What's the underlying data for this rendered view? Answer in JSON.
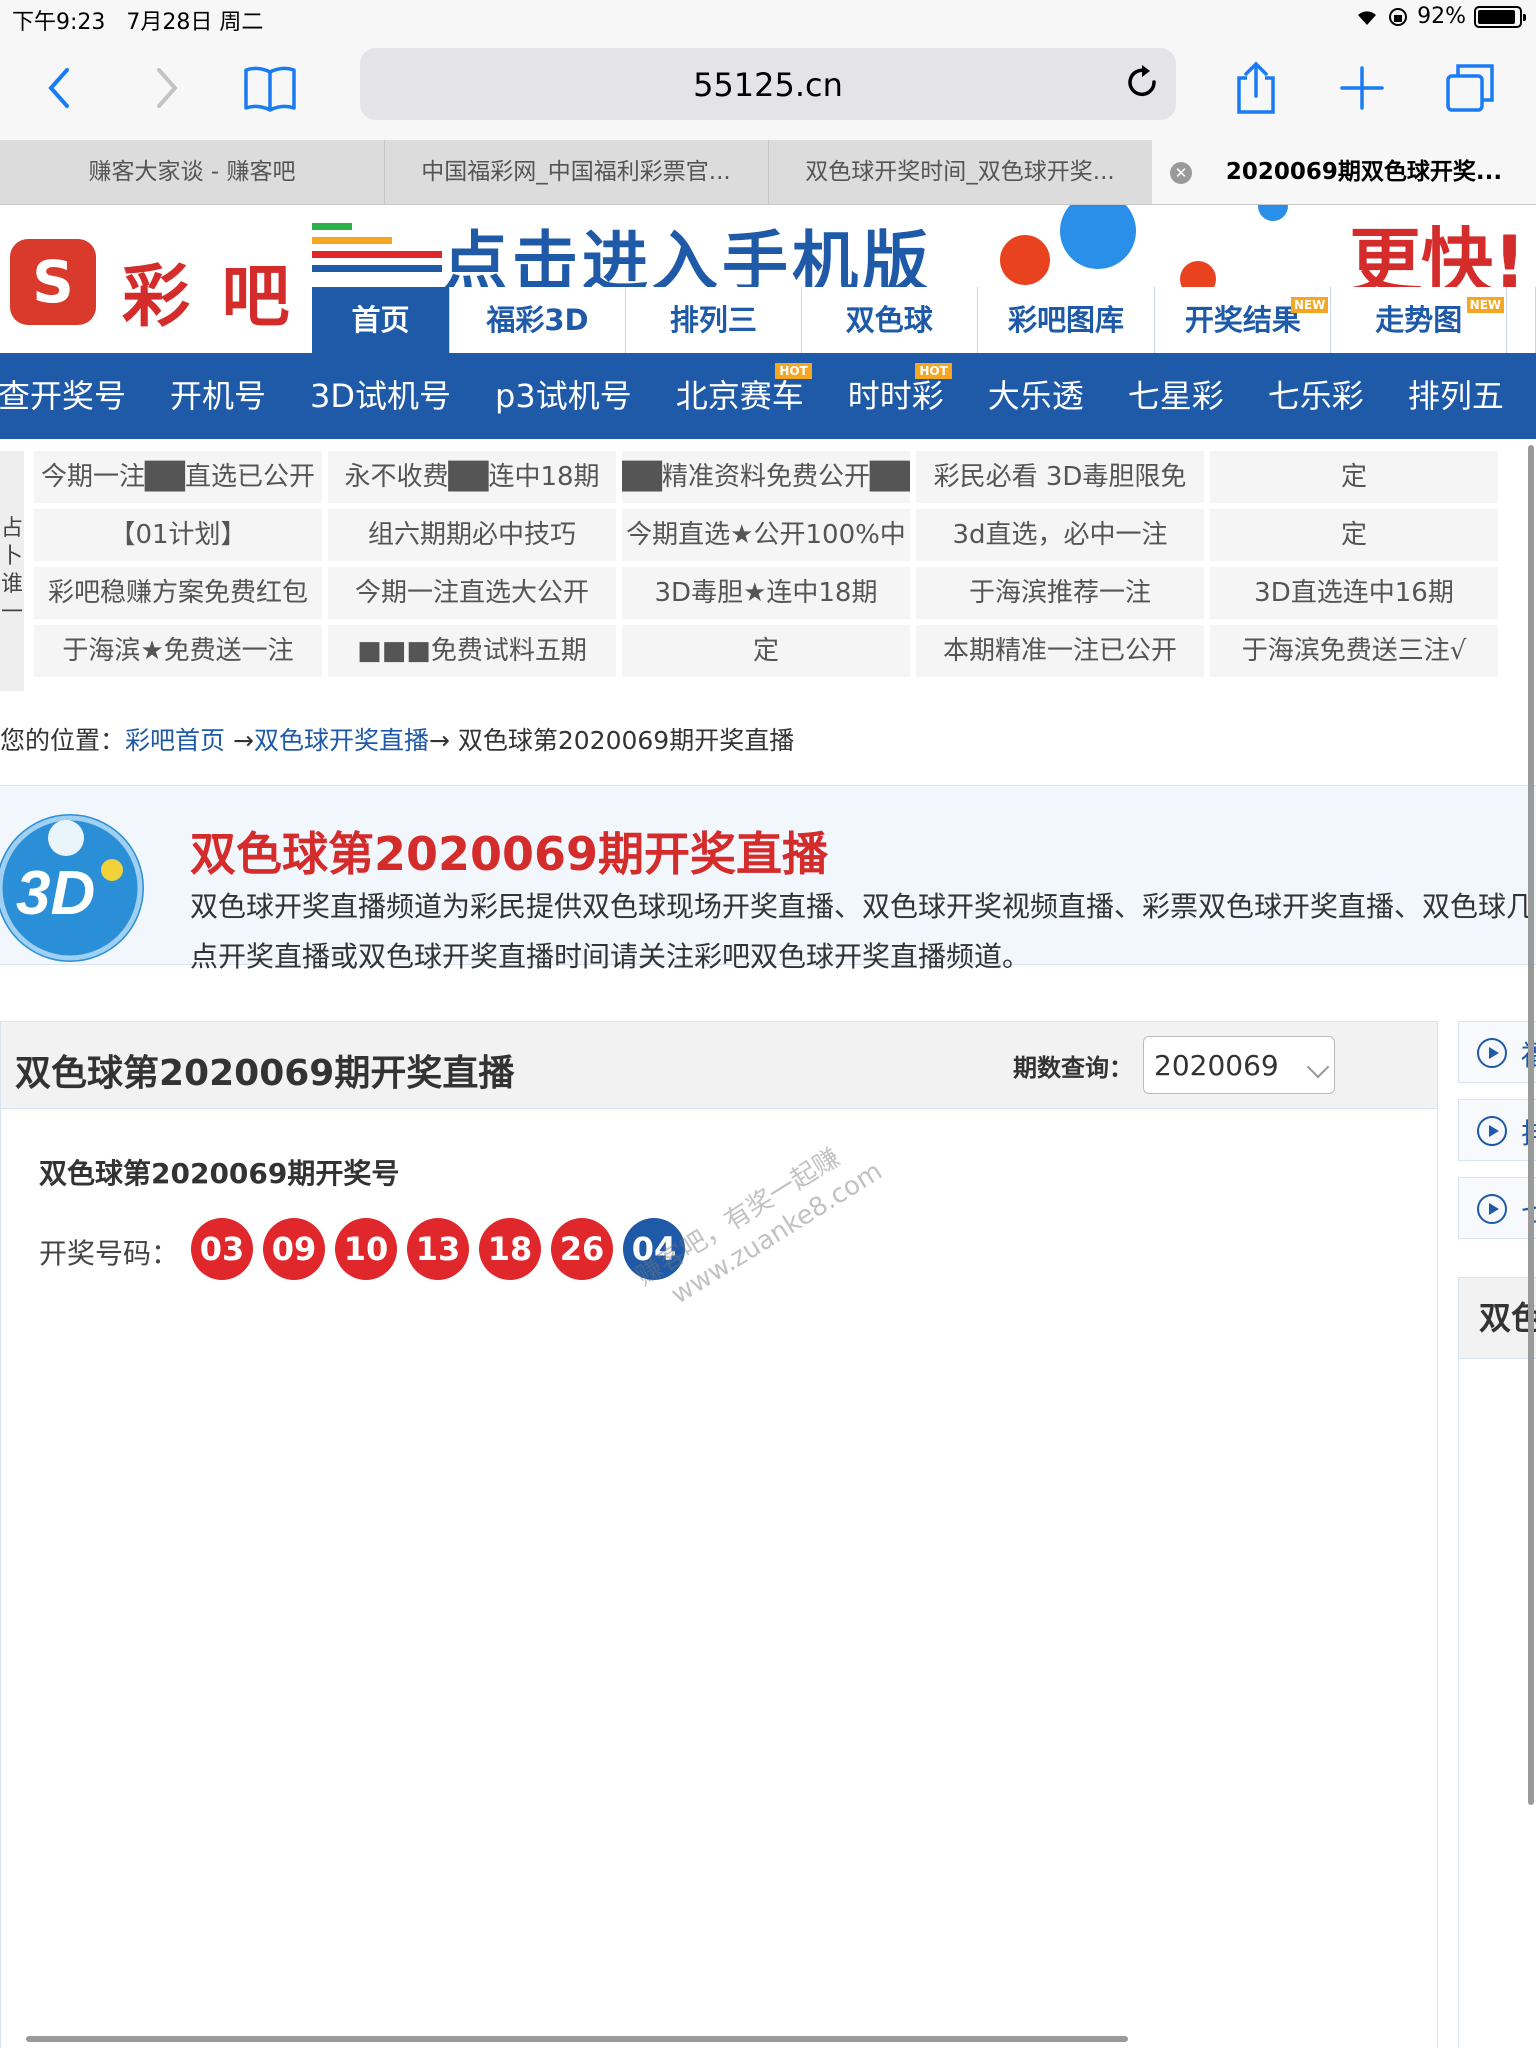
{
  "status": {
    "time": "下午9:23",
    "date": "7月28日 周二",
    "battery": "92%"
  },
  "browser": {
    "url": "55125.cn"
  },
  "tabs": [
    {
      "label": "赚客大家谈 - 赚客吧"
    },
    {
      "label": "中国福彩网_中国福利彩票官..."
    },
    {
      "label": "双色球开奖时间_双色球开奖..."
    },
    {
      "label": "2020069期双色球开奖..."
    }
  ],
  "header": {
    "logo_text": "彩 吧",
    "banner_text": "点击进入手机版",
    "banner_right": "更快!",
    "nav": [
      {
        "label": "首页",
        "badge": ""
      },
      {
        "label": "福彩3D",
        "badge": ""
      },
      {
        "label": "排列三",
        "badge": ""
      },
      {
        "label": "双色球",
        "badge": ""
      },
      {
        "label": "彩吧图库",
        "badge": ""
      },
      {
        "label": "开奖结果",
        "badge": "NEW"
      },
      {
        "label": "走势图",
        "badge": "NEW"
      }
    ]
  },
  "subnav": [
    {
      "label": "查开奖号",
      "badge": ""
    },
    {
      "label": "开机号",
      "badge": ""
    },
    {
      "label": "3D试机号",
      "badge": ""
    },
    {
      "label": "p3试机号",
      "badge": ""
    },
    {
      "label": "北京赛车",
      "badge": "HOT"
    },
    {
      "label": "时时彩",
      "badge": "HOT"
    },
    {
      "label": "大乐透",
      "badge": ""
    },
    {
      "label": "七星彩",
      "badge": ""
    },
    {
      "label": "七乐彩",
      "badge": ""
    },
    {
      "label": "排列五",
      "badge": ""
    }
  ],
  "ad_side_text": "占卜谁一",
  "ad_rows": [
    [
      "今期一注██直选已公开",
      "永不收费██连中18期",
      "██精准资料免费公开██",
      "彩民必看 3D毒胆限免",
      "定"
    ],
    [
      "【01计划】",
      "组六期期必中技巧",
      "今期直选★公开100%中",
      "3d直选，必中一注",
      "定"
    ],
    [
      "彩吧稳赚方案免费红包",
      "今期一注直选大公开",
      "3D毒胆★连中18期",
      "于海滨推荐一注",
      "3D直选连中16期"
    ],
    [
      "于海滨★免费送一注",
      "■■■免费试料五期",
      "定",
      "本期精准一注已公开",
      "于海滨免费送三注√"
    ]
  ],
  "breadcrumb": {
    "prefix": "您的位置：",
    "home": "彩吧首页",
    "arrow1": " →",
    "section": "双色球开奖直播",
    "arrow2": "→ ",
    "current": "双色球第2020069期开奖直播"
  },
  "intro": {
    "title": "双色球第2020069期开奖直播",
    "description": "双色球开奖直播频道为彩民提供双色球现场开奖直播、双色球开奖视频直播、彩票双色球开奖直播、双色球几点开奖直播或双色球开奖直播时间请关注彩吧双色球开奖直播频道。"
  },
  "panel": {
    "title": "双色球第2020069期开奖直播",
    "period_label": "期数查询：",
    "period_value": "2020069",
    "result_title": "双色球第2020069期开奖号",
    "result_label": "开奖号码：",
    "red_balls": [
      "03",
      "09",
      "10",
      "13",
      "18",
      "26"
    ],
    "blue_ball": "04"
  },
  "sidebar": {
    "buttons": [
      {
        "peek": "福"
      },
      {
        "peek": "排"
      },
      {
        "peek": "七"
      }
    ],
    "box_title": "双色"
  },
  "watermark": {
    "line1": "赚客吧，有奖一起赚",
    "line2": "www.zuanke8.com"
  },
  "colors": {
    "brand_blue": "#1e5aa8",
    "brand_red": "#d42b2b",
    "red_ball": "#e0272b",
    "blue_ball": "#1e5aa8"
  }
}
